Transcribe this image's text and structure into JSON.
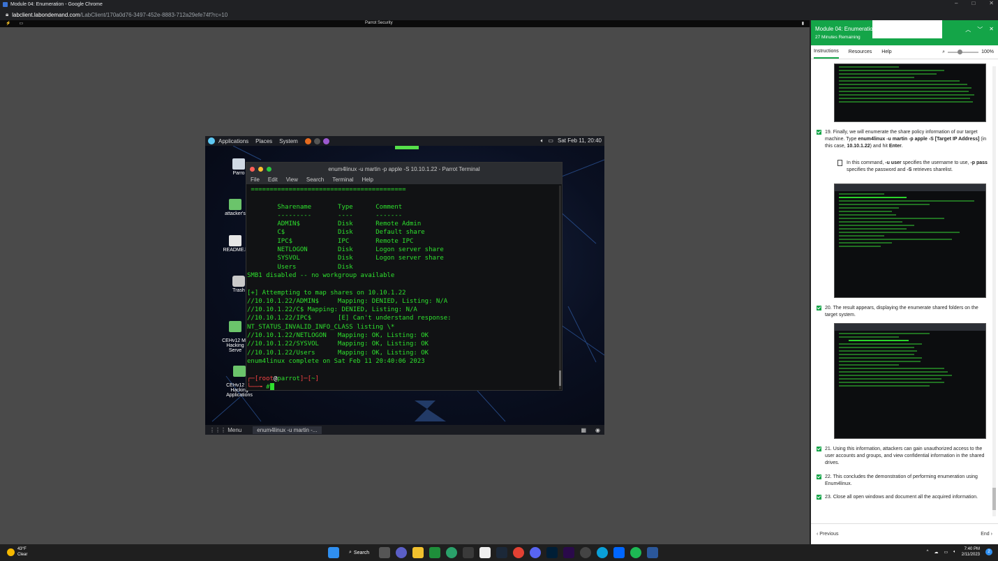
{
  "browser": {
    "title": "Module 04: Enumeration - Google Chrome",
    "url_host": "labclient.labondemand.com",
    "url_path": "/LabClient/170a0d76-3497-452e-8883-712a29efe74f?rc=10",
    "window_controls": [
      "–",
      "□",
      "✕"
    ]
  },
  "lab_toolbar": {
    "machine_name": "Parrot Security",
    "left_icons": [
      "lightning-icon",
      "monitor-icon"
    ],
    "right_icon": "signal-icon"
  },
  "vm": {
    "topbar": {
      "menus": [
        "Applications",
        "Places",
        "System"
      ],
      "clock": "Sat Feb 11, 20:40"
    },
    "desktop_icons": [
      {
        "label": "Parro",
        "kind": "mon"
      },
      {
        "label": "attacker's",
        "kind": "folder"
      },
      {
        "label": "README.li",
        "kind": "doc"
      },
      {
        "label": "Trash",
        "kind": "trash"
      },
      {
        "label": "CEHv12 Mo\nHacking\nServe",
        "kind": "folder"
      },
      {
        "label": "CEHv12 Mo\nHacking\nApplications",
        "kind": "folder"
      }
    ],
    "terminal": {
      "title": "enum4linux -u martin -p apple -S 10.10.1.22 - Parrot Terminal",
      "menus": [
        "File",
        "Edit",
        "View",
        "Search",
        "Terminal",
        "Help"
      ],
      "lines": [
        " =========================================",
        "",
        "        Sharename       Type      Comment",
        "        ---------       ----      -------",
        "        ADMIN$          Disk      Remote Admin",
        "        C$              Disk      Default share",
        "        IPC$            IPC       Remote IPC",
        "        NETLOGON        Disk      Logon server share",
        "        SYSVOL          Disk      Logon server share",
        "        Users           Disk",
        "SMB1 disabled -- no workgroup available",
        "",
        "[+] Attempting to map shares on 10.10.1.22",
        "//10.10.1.22/ADMIN$     Mapping: DENIED, Listing: N/A",
        "//10.10.1.22/C$ Mapping: DENIED, Listing: N/A",
        "//10.10.1.22/IPC$       [E] Can't understand response:",
        "NT_STATUS_INVALID_INFO_CLASS listing \\*",
        "//10.10.1.22/NETLOGON   Mapping: OK, Listing: OK",
        "//10.10.1.22/SYSVOL     Mapping: OK, Listing: OK",
        "//10.10.1.22/Users      Mapping: OK, Listing: OK",
        "enum4linux complete on Sat Feb 11 20:40:06 2023",
        ""
      ],
      "prompt_line1_a": "┌─[",
      "prompt_user": "root",
      "prompt_at": "@",
      "prompt_host": "parrot",
      "prompt_line1_b": "]─[",
      "prompt_dir": "~",
      "prompt_line1_c": "]",
      "prompt_line2": "└──╼ ",
      "prompt_hash": "#"
    },
    "bottombar": {
      "menu_label": "Menu",
      "task_label": "enum4linux -u martin -..."
    }
  },
  "panel": {
    "title": "Module 04: Enumeration",
    "subtitle": "27 Minutes Remaining",
    "tabs": [
      "Instructions",
      "Resources",
      "Help"
    ],
    "zoom": "100%",
    "step19": {
      "num": "19.",
      "text_a": "Finally, we will enumerate the share policy information of our target machine. Type ",
      "cmd": "enum4linux -u martin -p apple -S [Target IP Address]",
      "text_b": " (in this case, ",
      "ip": "10.10.1.22",
      "text_c": ") and hit ",
      "enter": "Enter",
      "text_d": "."
    },
    "note19": {
      "a": "In this command, ",
      "u": "-u user",
      "b": " specifies the username to use, ",
      "p": "-p pass",
      "c": " specifies the password and ",
      "s": "-S",
      "d": " retrieves sharelist."
    },
    "step20": {
      "num": "20.",
      "text": "The result appears, displaying the enumerate shared folders on the target system."
    },
    "step21": {
      "num": "21.",
      "text": "Using this information, attackers can gain unauthorized access to the user accounts and groups, and view confidential information in the shared drives."
    },
    "step22": {
      "num": "22.",
      "text": "This concludes the demonstration of performing enumeration using Enum4linux."
    },
    "step23": {
      "num": "23.",
      "text": "Close all open windows and document all the acquired information."
    },
    "footer": {
      "previous": "Previous",
      "end": "End"
    }
  },
  "taskbar": {
    "weather_temp": "43°F",
    "weather_text": "Clear",
    "search_label": "Search",
    "time": "7:40 PM",
    "date": "2/11/2023",
    "notification_count": "2"
  },
  "colors": {
    "accent_green": "#14a548",
    "terminal_green": "#2ee02e",
    "prompt_red": "#ff4545"
  }
}
